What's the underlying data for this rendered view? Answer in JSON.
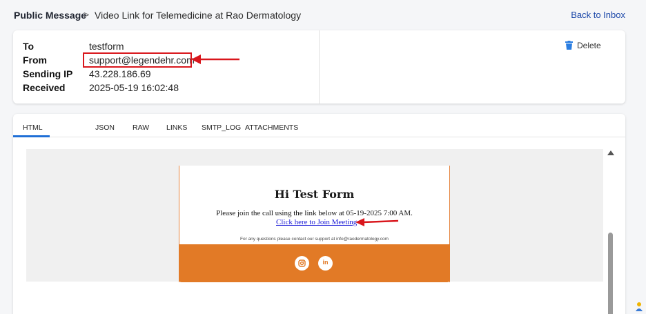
{
  "breadcrumb": {
    "root": "Public Message",
    "separator": ">",
    "current": "Video Link for Telemedicine at Rao Dermatology",
    "back_label": "Back to Inbox"
  },
  "message": {
    "fields": [
      {
        "label": "To",
        "value": "testform"
      },
      {
        "label": "From",
        "value": "support@legendehr.com"
      },
      {
        "label": "Sending IP",
        "value": "43.228.186.69"
      },
      {
        "label": "Received",
        "value": "2025-05-19 16:02:48"
      }
    ],
    "delete_label": "Delete"
  },
  "tabs": [
    "HTML",
    "JSON",
    "RAW",
    "LINKS",
    "SMTP_LOG",
    "ATTACHMENTS"
  ],
  "active_tab": "HTML",
  "email": {
    "title": "Hi Test Form",
    "text": "Please join the call using the link below at 05-19-2025 7:00 AM.",
    "link": "Click here to Join Meeting",
    "support_text": "For any questions please contact our support at info@raodermatology.com",
    "social_icons": [
      "instagram-icon",
      "linkedin-icon"
    ],
    "linkedin_glyph": "in"
  },
  "colors": {
    "accent": "#1f6fd6",
    "link": "#1a46a8",
    "email_footer": "#e27a26",
    "annotation_red": "#d9161c"
  },
  "icons": [
    "chevron-right-icon",
    "trash-icon",
    "scroll-up-icon",
    "annotation-arrow-icon",
    "assistant-icon"
  ]
}
